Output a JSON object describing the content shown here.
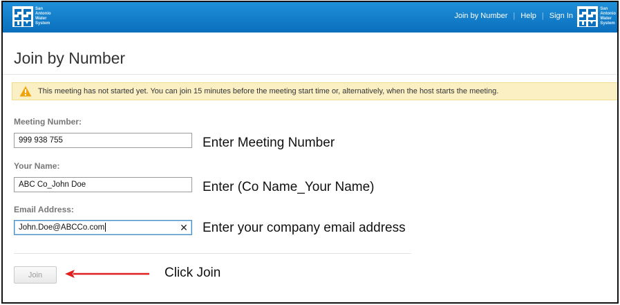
{
  "brand": {
    "lines": [
      "San",
      "Antonio",
      "Water",
      "System"
    ],
    "color": "#0a6fbd"
  },
  "nav": {
    "join_by_number": "Join by Number",
    "help": "Help",
    "sign_in": "Sign In",
    "separator": "|"
  },
  "page": {
    "title": "Join by Number"
  },
  "warning": {
    "icon": "warning-triangle-icon",
    "text": "This meeting has not started yet. You can join 15 minutes before the meeting start time or, alternatively, when the host starts the meeting."
  },
  "form": {
    "meeting_number": {
      "label": "Meeting Number:",
      "value": "999 938 755"
    },
    "your_name": {
      "label": "Your Name:",
      "value": "ABC Co_John Doe"
    },
    "email": {
      "label": "Email Address:",
      "value": "John.Doe@ABCCo.com",
      "clear_icon": "✕"
    },
    "join_label": "Join"
  },
  "annotations": {
    "meeting_number": "Enter Meeting Number",
    "your_name": "Enter (Co Name_Your Name)",
    "email": "Enter your company email address",
    "join": "Click Join",
    "arrow_color": "#e02020"
  }
}
